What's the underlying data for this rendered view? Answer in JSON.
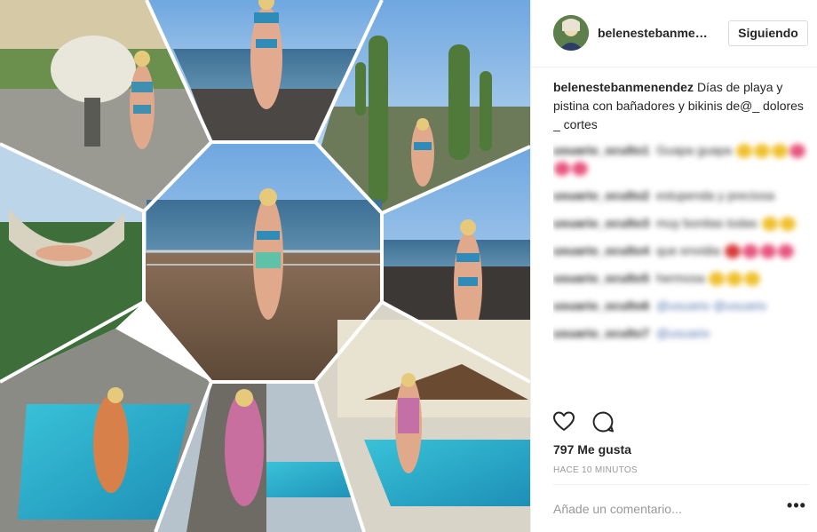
{
  "post": {
    "username": "belenestebanme…",
    "follow_label": "Siguiendo"
  },
  "caption": {
    "username": "belenestebanmenendez",
    "text": "Días de playa y pistina con bañadores y bikinis de@_ dolores _ cortes"
  },
  "blurred_comments": [
    {
      "user": "usuario_oculto1",
      "text": "Guapa guapa"
    },
    {
      "user": "usuario_oculto2",
      "text": "estupenda y preciosa"
    },
    {
      "user": "usuario_oculto3",
      "text": "muy bonitas todas"
    },
    {
      "user": "usuario_oculto4",
      "text": "que envidia"
    },
    {
      "user": "usuario_oculto5",
      "text": "hermosa"
    },
    {
      "user": "usuario_oculto6",
      "text": "@usuario @usuario"
    },
    {
      "user": "usuario_oculto7",
      "text": "@usuario"
    }
  ],
  "stats": {
    "likes": "797 Me gusta",
    "time": "HACE 10 MINUTOS"
  },
  "comment_box": {
    "placeholder": "Añade un comentario...",
    "more_label": "•••"
  },
  "icons": {
    "like": "heart-outline-icon",
    "comment": "speech-bubble-icon",
    "more": "ellipsis-icon"
  },
  "colors": {
    "text": "#262626",
    "muted": "#999999",
    "border": "#dbdbdb",
    "divider": "#efefef"
  }
}
